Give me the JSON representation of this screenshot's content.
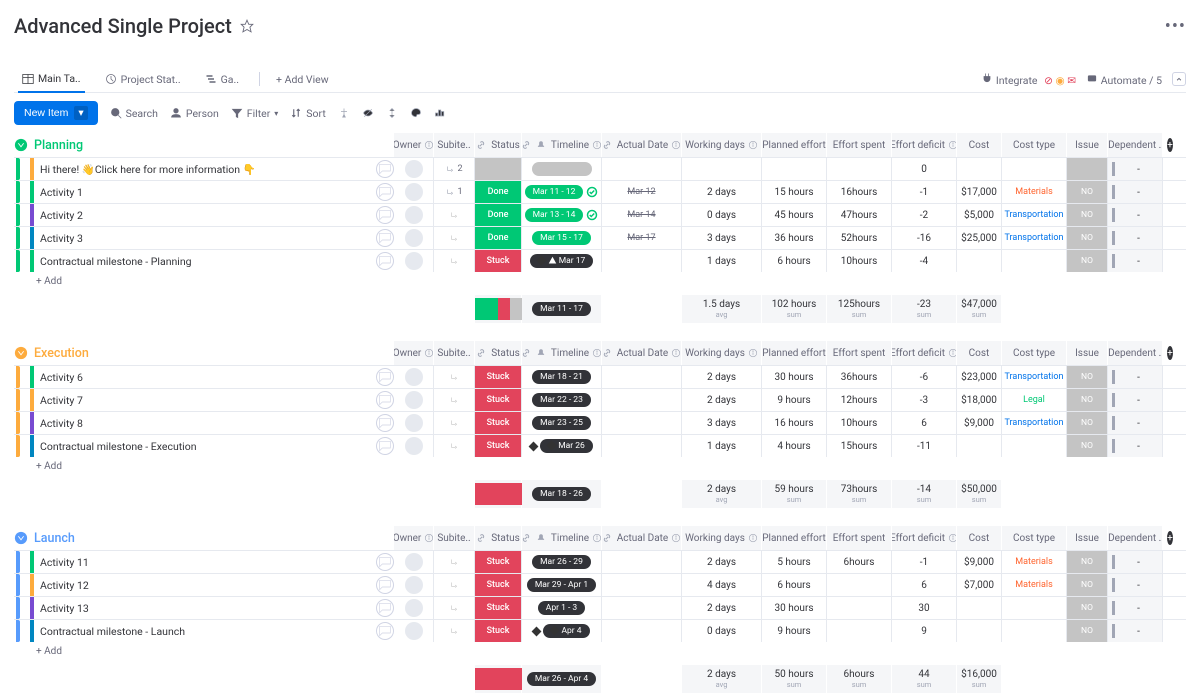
{
  "title": "Advanced Single Project",
  "tabs": {
    "main": "Main Ta..",
    "status": "Project Stat..",
    "ga": "Ga..",
    "add_view": "+  Add View"
  },
  "topbar_right": {
    "integrate": "Integrate",
    "automate": "Automate / 5"
  },
  "toolbar": {
    "new_item": "New Item",
    "search": "Search",
    "person": "Person",
    "filter": "Filter",
    "sort": "Sort"
  },
  "columns": {
    "owner": "Owner",
    "subitems": "Subite..",
    "status": "Status",
    "timeline": "Timeline",
    "actual_date": "Actual Date",
    "working_days": "Working days",
    "planned_effort": "Planned effort",
    "effort_spent": "Effort spent",
    "effort_deficit": "Effort deficit",
    "cost": "Cost",
    "cost_type": "Cost type",
    "issue": "Issue",
    "dependent": "Dependent .."
  },
  "groups": [
    {
      "name": "Planning",
      "color_class": "grp-planning",
      "rows": [
        {
          "task": "Hi there! 👋Click here for more information 👇",
          "bar_inner": "#fdab3d",
          "bar": "#00c875",
          "subitems": "2",
          "status": "",
          "status_class": "empty-status",
          "timeline": "",
          "tl_class": "gray",
          "actual": "",
          "wd": "",
          "pe": "",
          "es": "",
          "ed": "0",
          "cost": "",
          "ct": "",
          "issue": "",
          "dep": "-"
        },
        {
          "task": "Activity 1",
          "bar": "#00c875",
          "bar_inner": "#00c875",
          "subitems": "1",
          "status": "Done",
          "status_class": "done",
          "timeline": "Mar 11 - 12",
          "tl_class": "green",
          "check": true,
          "actual": "Mar 12",
          "wd": "2 days",
          "pe": "15 hours",
          "es": "16hours",
          "ed": "-1",
          "cost": "$17,000",
          "ct": "Materials",
          "ct_class": "materials",
          "issue": "NO",
          "dep": "-"
        },
        {
          "task": "Activity 2",
          "bar": "#00c875",
          "bar_inner": "#784bd1",
          "status": "Done",
          "status_class": "done",
          "timeline": "Mar 13 - 14",
          "tl_class": "green",
          "check": true,
          "actual": "Mar 14",
          "wd": "0 days",
          "pe": "45 hours",
          "es": "47hours",
          "ed": "-2",
          "cost": "$5,000",
          "ct": "Transportation",
          "ct_class": "transportation",
          "issue": "NO",
          "dep": "-"
        },
        {
          "task": "Activity 3",
          "bar": "#00c875",
          "bar_inner": "#0086c0",
          "status": "Done",
          "status_class": "done",
          "timeline": "Mar 15 - 17",
          "tl_class": "green",
          "actual": "Mar 17",
          "wd": "3 days",
          "pe": "36 hours",
          "es": "52hours",
          "ed": "-16",
          "cost": "$25,000",
          "ct": "Transportation",
          "ct_class": "transportation",
          "issue": "NO",
          "dep": "-"
        },
        {
          "task": "Contractual milestone - Planning",
          "bar": "#00c875",
          "bar_inner": "#00c875",
          "status": "Stuck",
          "status_class": "stuck",
          "timeline": "Mar 17",
          "tl_class": "",
          "diamond": true,
          "warn": true,
          "wd": "1 days",
          "pe": "6 hours",
          "es": "10hours",
          "ed": "-4",
          "cost": "",
          "issue": "NO",
          "dep": "-"
        }
      ],
      "add": "+ Add",
      "summary": {
        "status_segs": [
          {
            "c": "#00c875",
            "w": "50%"
          },
          {
            "c": "#e2445c",
            "w": "25%"
          },
          {
            "c": "#c4c4c4",
            "w": "25%"
          }
        ],
        "timeline": "Mar 11 - 17",
        "wd": "1.5 days",
        "wd_sub": "avg",
        "pe": "102 hours",
        "pe_sub": "sum",
        "es": "125hours",
        "es_sub": "sum",
        "ed": "-23",
        "ed_sub": "sum",
        "cost": "$47,000",
        "cost_sub": "sum"
      }
    },
    {
      "name": "Execution",
      "color_class": "grp-execution",
      "rows": [
        {
          "task": "Activity 6",
          "bar": "#fdab3d",
          "bar_inner": "#00c875",
          "status": "Stuck",
          "status_class": "stuck",
          "timeline": "Mar 18 - 21",
          "wd": "2 days",
          "pe": "30 hours",
          "es": "36hours",
          "ed": "-6",
          "cost": "$23,000",
          "ct": "Transportation",
          "ct_class": "transportation",
          "issue": "NO",
          "dep": "-"
        },
        {
          "task": "Activity 7",
          "bar": "#fdab3d",
          "bar_inner": "#fdab3d",
          "status": "Stuck",
          "status_class": "stuck",
          "timeline": "Mar 22 - 23",
          "wd": "2 days",
          "pe": "9 hours",
          "es": "12hours",
          "ed": "-3",
          "cost": "$18,000",
          "ct": "Legal",
          "ct_class": "legal",
          "issue": "NO",
          "dep": "-"
        },
        {
          "task": "Activity 8",
          "bar": "#fdab3d",
          "bar_inner": "#784bd1",
          "status": "Stuck",
          "status_class": "stuck",
          "timeline": "Mar 23 - 25",
          "wd": "3 days",
          "pe": "16 hours",
          "es": "10hours",
          "ed": "6",
          "cost": "$9,000",
          "ct": "Transportation",
          "ct_class": "transportation",
          "issue": "NO",
          "dep": "-"
        },
        {
          "task": "Contractual milestone - Execution",
          "bar": "#fdab3d",
          "bar_inner": "#0086c0",
          "status": "Stuck",
          "status_class": "stuck",
          "timeline": "Mar 26",
          "diamond": true,
          "wd": "1 days",
          "pe": "4 hours",
          "es": "15hours",
          "ed": "-11",
          "issue": "NO",
          "dep": "-"
        }
      ],
      "add": "+ Add",
      "summary": {
        "status_segs": [
          {
            "c": "#e2445c",
            "w": "100%"
          }
        ],
        "timeline": "Mar 18 - 26",
        "wd": "2 days",
        "wd_sub": "avg",
        "pe": "59 hours",
        "pe_sub": "sum",
        "es": "73hours",
        "es_sub": "sum",
        "ed": "-14",
        "ed_sub": "sum",
        "cost": "$50,000",
        "cost_sub": "sum"
      }
    },
    {
      "name": "Launch",
      "color_class": "grp-launch",
      "rows": [
        {
          "task": "Activity 11",
          "bar": "#579bfc",
          "bar_inner": "#00c875",
          "status": "Stuck",
          "status_class": "stuck",
          "timeline": "Mar 26 - 29",
          "wd": "2 days",
          "pe": "5 hours",
          "es": "6hours",
          "ed": "-1",
          "cost": "$9,000",
          "ct": "Materials",
          "ct_class": "materials",
          "issue": "NO",
          "dep": "-"
        },
        {
          "task": "Activity 12",
          "bar": "#579bfc",
          "bar_inner": "#fdab3d",
          "status": "Stuck",
          "status_class": "stuck",
          "timeline": "Mar 29 - Apr 1",
          "wd": "4 days",
          "pe": "6 hours",
          "ed": "6",
          "cost": "$7,000",
          "ct": "Materials",
          "ct_class": "materials",
          "issue": "NO",
          "dep": "-"
        },
        {
          "task": "Activity 13",
          "bar": "#579bfc",
          "bar_inner": "#784bd1",
          "status": "Stuck",
          "status_class": "stuck",
          "timeline": "Apr 1 - 3",
          "wd": "2 days",
          "pe": "30 hours",
          "ed": "30",
          "issue": "NO",
          "dep": "-"
        },
        {
          "task": "Contractual milestone - Launch",
          "bar": "#579bfc",
          "bar_inner": "#0086c0",
          "status": "Stuck",
          "status_class": "stuck",
          "timeline": "Apr 4",
          "diamond": true,
          "wd": "0 days",
          "pe": "9 hours",
          "ed": "9",
          "issue": "NO",
          "dep": "-"
        }
      ],
      "add": "+ Add",
      "summary": {
        "status_segs": [
          {
            "c": "#e2445c",
            "w": "100%"
          }
        ],
        "timeline": "Mar 26 - Apr 4",
        "wd": "2 days",
        "wd_sub": "avg",
        "pe": "50 hours",
        "pe_sub": "sum",
        "es": "6hours",
        "es_sub": "sum",
        "ed": "44",
        "ed_sub": "sum",
        "cost": "$16,000",
        "cost_sub": "sum"
      }
    }
  ]
}
